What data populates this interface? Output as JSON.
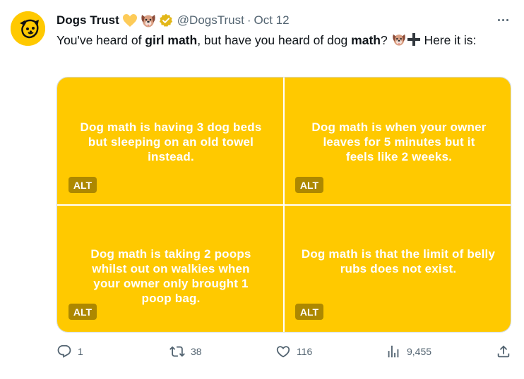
{
  "author": {
    "display_name": "Dogs Trust",
    "handle": "@DogsTrust",
    "separator": "·",
    "timestamp": "Oct 12"
  },
  "tweet": {
    "text_parts": [
      "You've heard of ",
      "girl math",
      ", but have you heard of dog ",
      "math",
      "?",
      " Here it is:"
    ]
  },
  "media": {
    "images": [
      {
        "text": "Dog math is having 3 dog beds but sleeping on an old towel instead.",
        "alt_label": "ALT"
      },
      {
        "text": "Dog math is when your owner leaves for 5 minutes but it feels like 2 weeks.",
        "alt_label": "ALT"
      },
      {
        "text": "Dog math is taking 2 poops whilst out on walkies when your owner only brought 1 poop bag.",
        "alt_label": "ALT"
      },
      {
        "text": "Dog math is that the limit of belly rubs does not exist.",
        "alt_label": "ALT"
      }
    ],
    "background_color": "#ffc900"
  },
  "actions": {
    "replies": "1",
    "retweets": "38",
    "likes": "116",
    "views": "9,455"
  },
  "colors": {
    "text_primary": "#0f1419",
    "text_secondary": "#536471",
    "brand_yellow": "#ffc900",
    "verified_gold": "#e2b719"
  },
  "icons": [
    "more-icon",
    "verified-badge-icon",
    "yellow-heart-icon",
    "dog-face-icon",
    "plus-icon",
    "reply-icon",
    "retweet-icon",
    "like-icon",
    "views-icon",
    "share-icon"
  ]
}
